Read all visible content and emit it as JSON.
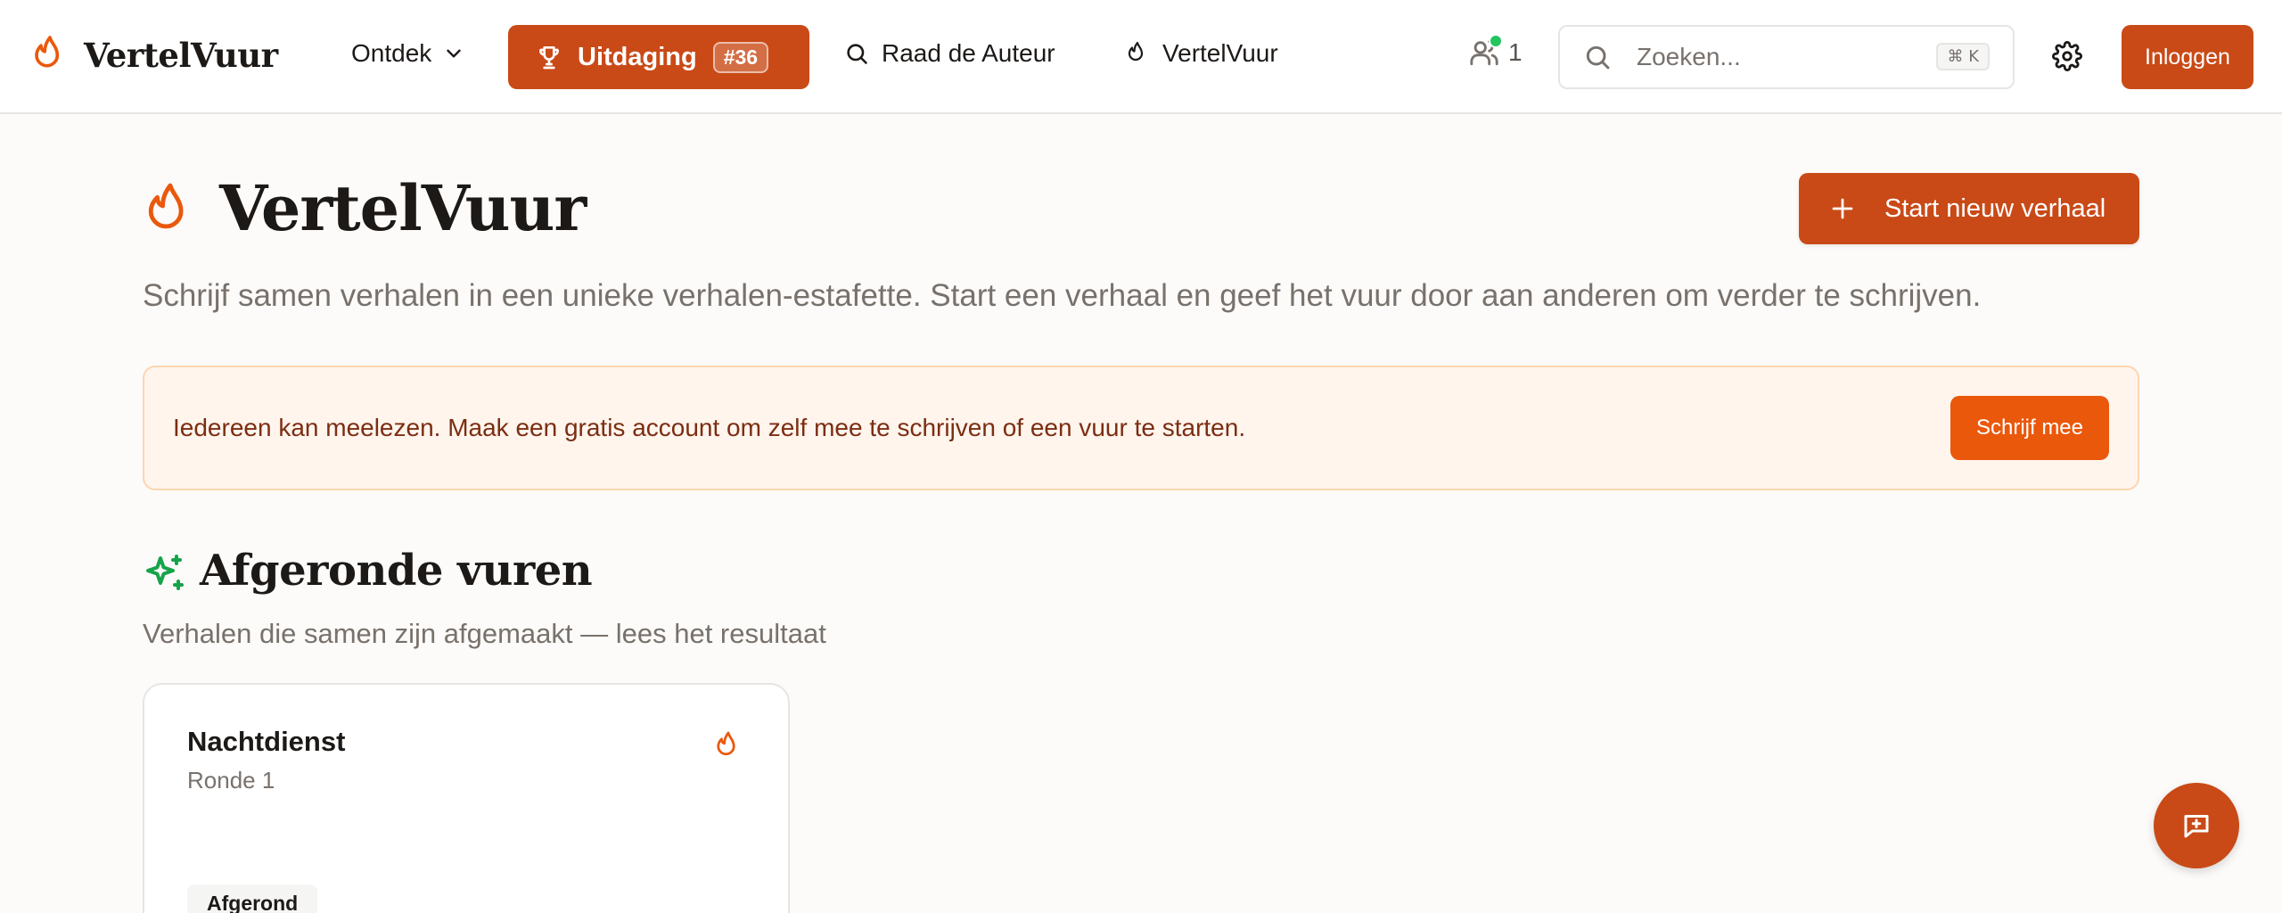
{
  "header": {
    "brand": "VertelVuur",
    "nav": {
      "ontdek_label": "Ontdek",
      "uitdaging_label": "Uitdaging",
      "uitdaging_badge": "#36",
      "raad_label": "Raad de Auteur",
      "vertelvuur_label": "VertelVuur"
    },
    "online_count": "1",
    "search": {
      "placeholder": "Zoeken...",
      "shortcut": "⌘ K"
    },
    "login_label": "Inloggen"
  },
  "hero": {
    "title": "VertelVuur",
    "subtitle": "Schrijf samen verhalen in een unieke verhalen-estafette. Start een verhaal en geef het vuur door aan anderen om verder te schrijven.",
    "start_button": "Start nieuw verhaal"
  },
  "banner": {
    "text": "Iedereen kan meelezen. Maak een gratis account om zelf mee te schrijven of een vuur te starten.",
    "button": "Schrijf mee"
  },
  "section": {
    "title": "Afgeronde vuren",
    "subtitle": "Verhalen die samen zijn afgemaakt — lees het resultaat",
    "cards": [
      {
        "title": "Nachtdienst",
        "round": "Ronde 1",
        "status": "Afgerond"
      }
    ]
  },
  "colors": {
    "brand": "#c94a17",
    "accent_orange": "#ea580c",
    "banner_bg": "#fff5ed",
    "success_green": "#16a34a",
    "online_green": "#22c55e"
  },
  "icons": {
    "brand": "flame-icon",
    "ontdek": "chevron-down-icon",
    "uitdaging": "trophy-icon",
    "raad": "search-icon",
    "online": "users-icon",
    "search": "search-icon",
    "settings": "gear-icon",
    "start": "plus-icon",
    "section": "sparkles-icon",
    "fab": "message-plus-icon"
  }
}
